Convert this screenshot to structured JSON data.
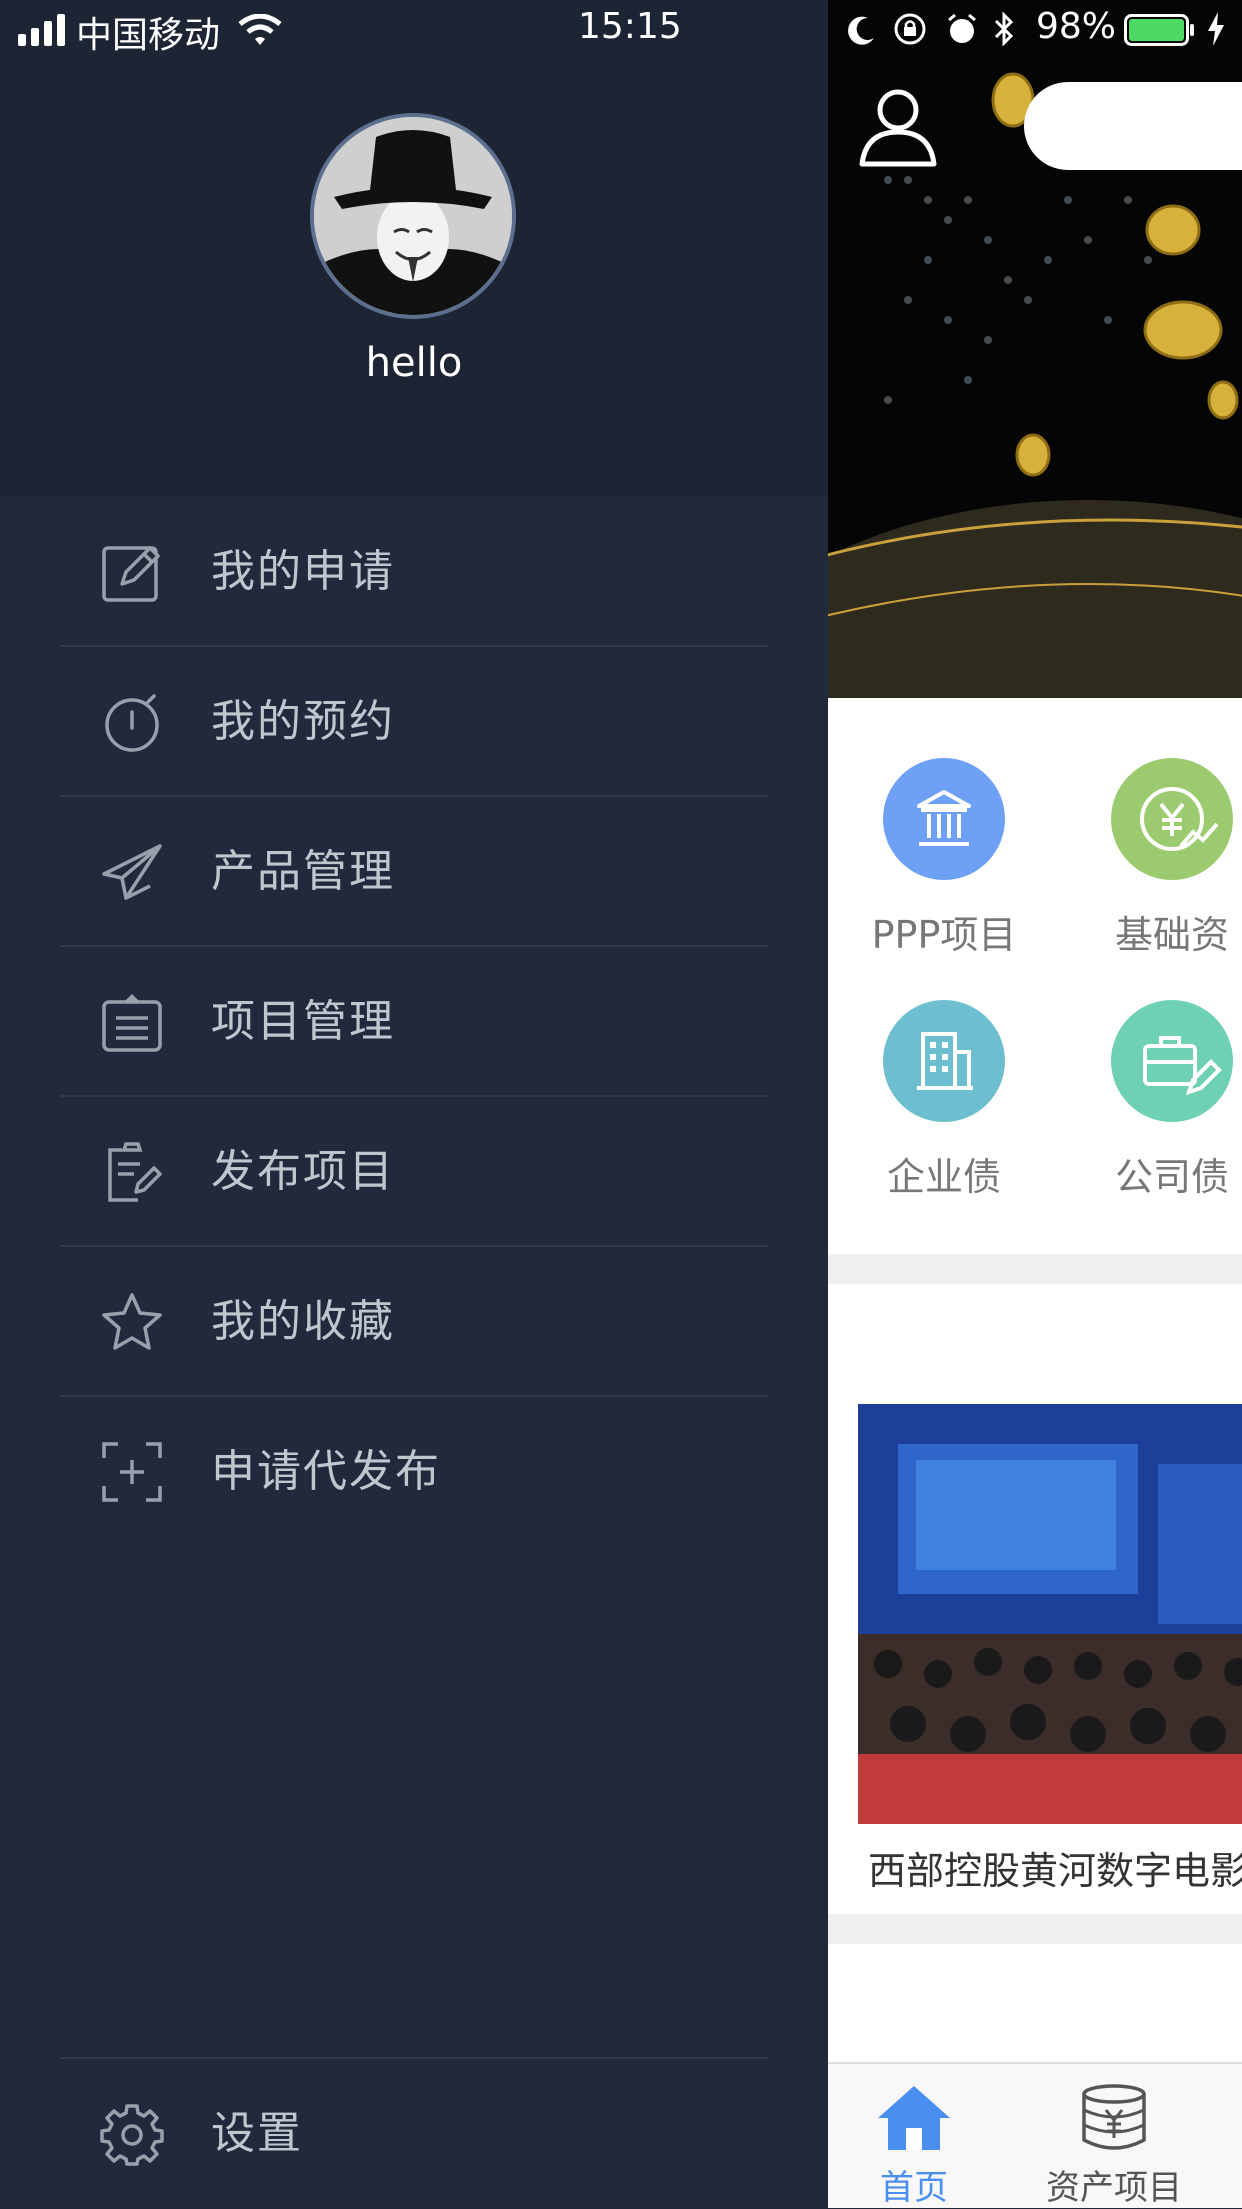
{
  "status_bar": {
    "carrier": "中国移动",
    "time": "15:15",
    "battery": "98%"
  },
  "drawer": {
    "username": "hello",
    "menu": [
      {
        "label": "我的申请",
        "icon": "edit-icon"
      },
      {
        "label": "我的预约",
        "icon": "stopwatch-icon"
      },
      {
        "label": "产品管理",
        "icon": "paper-plane-icon"
      },
      {
        "label": "项目管理",
        "icon": "clipboard-icon"
      },
      {
        "label": "发布项目",
        "icon": "document-edit-icon"
      },
      {
        "label": "我的收藏",
        "icon": "star-icon"
      },
      {
        "label": "申请代发布",
        "icon": "add-frame-icon"
      }
    ],
    "settings_label": "设置"
  },
  "main": {
    "categories": [
      {
        "label": "PPP项目",
        "color": "#6ea1f5",
        "icon": "bank-icon"
      },
      {
        "label": "基础资",
        "color": "#9bcb6e",
        "icon": "yuan-chart-icon"
      },
      {
        "label": "企业债",
        "color": "#6dbfcf",
        "icon": "building-icon"
      },
      {
        "label": "公司债",
        "color": "#6fd1b3",
        "icon": "briefcase-icon"
      }
    ],
    "news_title": "西部控股黄河数字电影",
    "tabs": [
      {
        "label": "首页",
        "active": true
      },
      {
        "label": "资产项目",
        "active": false
      }
    ],
    "accent_color": "#4a8ef0"
  }
}
